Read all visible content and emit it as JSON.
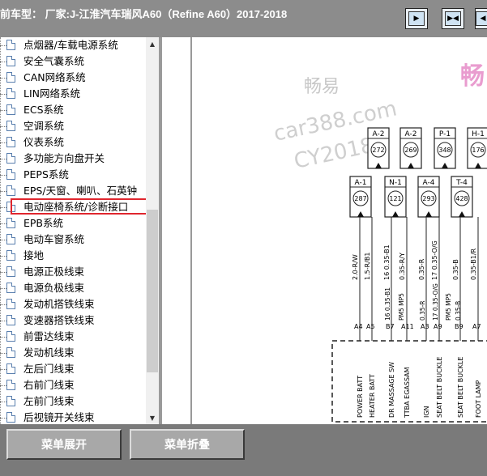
{
  "header": {
    "title": "前车型： 厂家:J-江淮汽车瑞风A60（Refine A60）2017-2018",
    "buttons": [
      "expand-right-icon",
      "expand-both-icon",
      "expand-left-icon"
    ]
  },
  "tree": {
    "items": [
      "点烟器/车载电源系统",
      "安全气囊系统",
      "CAN网络系统",
      "LIN网络系统",
      "ECS系统",
      "空调系统",
      "仪表系统",
      "多功能方向盘开关",
      "PEPS系统",
      "EPS/天窗、喇叭、石英钟",
      "电动座椅系统/诊断接口",
      "EPB系统",
      "电动车窗系统",
      "接地",
      "电源正极线束",
      "电源负极线束",
      "发动机搭铁线束",
      "变速器搭铁线束",
      "前雷达线束",
      "发动机线束",
      "左后门线束",
      "右前门线束",
      "左前门线束",
      "后视镜开关线束"
    ],
    "selected_index": 10
  },
  "diagram": {
    "watermark1": "畅易",
    "watermark2": "car388.com",
    "watermark3": "CY2018",
    "watermark4": "畅",
    "connectors_top": [
      {
        "id": "A-2",
        "num": "272"
      },
      {
        "id": "A-2",
        "num": "269"
      },
      {
        "id": "P-1",
        "num": "348"
      },
      {
        "id": "H-1",
        "num": "176"
      }
    ],
    "connectors_bottom": [
      {
        "id": "A-1",
        "num": "287"
      },
      {
        "id": "N-1",
        "num": "121"
      },
      {
        "id": "A-4",
        "num": "293"
      },
      {
        "id": "T-4",
        "num": "428"
      }
    ],
    "wires": [
      "2.0-R/W",
      "1.5-R/B1",
      "16  0.35-B1",
      "0.35-R/Y",
      "0.35-R",
      "17  0.35-O/G",
      "0.35-B",
      "0.35-B1/R"
    ],
    "wires_lower": [
      "16  0.35-B1",
      "PM5  MP5",
      "0.35-R",
      "17  0.35-O/G",
      "PM5  MP5",
      "0.35-B"
    ],
    "pins": [
      "A4",
      "A5",
      "B7",
      "A11",
      "A3",
      "A9",
      "B9",
      "A7"
    ],
    "labels": [
      "POWER BATT",
      "HEATER BATT",
      "DR MASSAGE SW",
      "TTBA EGASSAM",
      "IGN",
      "SEAT BELT BUCKLE",
      "SEAT BELT BUCKLE",
      "FOOT LAMP"
    ]
  },
  "footer": {
    "expand_label": "菜单展开",
    "collapse_label": "菜单折叠"
  }
}
